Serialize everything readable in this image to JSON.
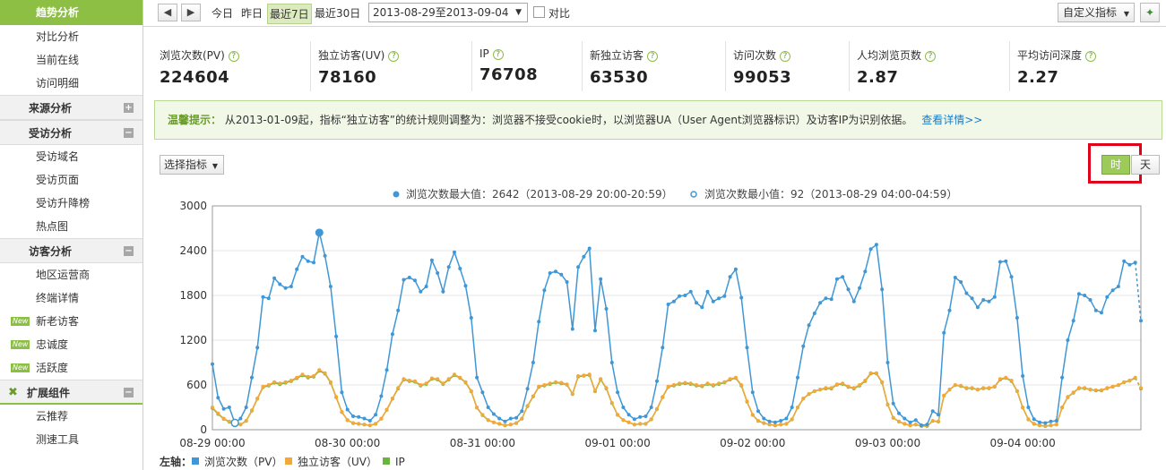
{
  "sidebar": {
    "items": [
      {
        "label": "趋势分析",
        "type": "active"
      },
      {
        "label": "对比分析",
        "type": "item"
      },
      {
        "label": "当前在线",
        "type": "item"
      },
      {
        "label": "访问明细",
        "type": "item"
      },
      {
        "label": "来源分析",
        "type": "group",
        "toggle": "+"
      },
      {
        "label": "受访分析",
        "type": "group",
        "toggle": "−"
      },
      {
        "label": "受访域名",
        "type": "item"
      },
      {
        "label": "受访页面",
        "type": "item"
      },
      {
        "label": "受访升降榜",
        "type": "item"
      },
      {
        "label": "热点图",
        "type": "item"
      },
      {
        "label": "访客分析",
        "type": "group",
        "toggle": "−"
      },
      {
        "label": "地区运营商",
        "type": "item"
      },
      {
        "label": "终端详情",
        "type": "item"
      },
      {
        "label": "新老访客",
        "type": "item",
        "badge": "New"
      },
      {
        "label": "忠诚度",
        "type": "item",
        "badge": "New"
      },
      {
        "label": "活跃度",
        "type": "item",
        "badge": "New"
      },
      {
        "label": "扩展组件",
        "type": "ext",
        "toggle": "−"
      },
      {
        "label": "云推荐",
        "type": "item"
      },
      {
        "label": "测速工具",
        "type": "item"
      }
    ]
  },
  "toolbar": {
    "today": "今日",
    "yesterday": "昨日",
    "last7": "最近7日",
    "last30": "最近30日",
    "date_range": "2013-08-29至2013-09-04",
    "compare": "对比",
    "custom_metric": "自定义指标"
  },
  "metrics": [
    {
      "label": "浏览次数(PV)",
      "value": "224604"
    },
    {
      "label": "独立访客(UV)",
      "value": "78160"
    },
    {
      "label": "IP",
      "value": "76708"
    },
    {
      "label": "新独立访客",
      "value": "63530"
    },
    {
      "label": "访问次数",
      "value": "99053"
    },
    {
      "label": "人均浏览页数",
      "value": "2.87"
    },
    {
      "label": "平均访问深度",
      "value": "2.27"
    }
  ],
  "notice": {
    "tip": "温馨提示：",
    "text": "从2013-01-09起，指标“独立访客”的统计规则调整为：浏览器不接受cookie时，以浏览器UA（User Agent浏览器标识）及访客IP为识别依据。",
    "link": "查看详情>>"
  },
  "controls": {
    "select_metric": "选择指标",
    "granularity_hour": "时",
    "granularity_day": "天"
  },
  "colors": {
    "pv": "#3f97d6",
    "uv": "#f2a93b",
    "ip": "#6cb33e",
    "accent": "#8dbf45",
    "highlight": "#e1001a"
  },
  "chart_data": {
    "type": "line",
    "max_note": "浏览次数最大值：2642（2013-08-29 20:00-20:59）",
    "min_note": "浏览次数最小值：92（2013-08-29 04:00-04:59）",
    "ylim": [
      0,
      3000
    ],
    "yticks": [
      "0",
      "600",
      "1200",
      "1800",
      "2400",
      "3000"
    ],
    "xticks": [
      "08-29 00:00",
      "08-30 00:00",
      "08-31 00:00",
      "09-01 00:00",
      "09-02 00:00",
      "09-03 00:00",
      "09-04 00:00"
    ],
    "legend_prefix": "左轴：",
    "series": [
      {
        "name": "浏览次数（PV）",
        "color": "#3f97d6",
        "values": [
          880,
          430,
          280,
          300,
          92,
          150,
          300,
          700,
          1100,
          1780,
          1760,
          2030,
          1950,
          1900,
          1920,
          2150,
          2320,
          2260,
          2240,
          2642,
          2330,
          1920,
          1250,
          500,
          270,
          180,
          170,
          150,
          120,
          200,
          450,
          800,
          1280,
          1600,
          2010,
          2040,
          2000,
          1850,
          1920,
          2270,
          2100,
          1850,
          2180,
          2380,
          2160,
          1930,
          1500,
          700,
          500,
          300,
          210,
          150,
          110,
          150,
          160,
          250,
          550,
          900,
          1450,
          1870,
          2100,
          2120,
          2080,
          1980,
          1350,
          2180,
          2320,
          2430,
          1330,
          2020,
          1620,
          900,
          500,
          300,
          200,
          140,
          170,
          180,
          300,
          650,
          1100,
          1680,
          1720,
          1790,
          1800,
          1850,
          1700,
          1640,
          1850,
          1720,
          1760,
          1790,
          2050,
          2150,
          1770,
          1100,
          500,
          250,
          150,
          110,
          100,
          120,
          150,
          300,
          700,
          1120,
          1400,
          1560,
          1700,
          1760,
          1750,
          2020,
          2050,
          1880,
          1720,
          1900,
          2120,
          2420,
          2480,
          1880,
          900,
          350,
          220,
          150,
          100,
          130,
          60,
          70,
          250,
          200,
          1300,
          1600,
          2040,
          1980,
          1830,
          1760,
          1640,
          1740,
          1720,
          1780,
          2250,
          2260,
          2050,
          1500,
          720,
          300,
          140,
          100,
          90,
          110,
          120,
          700,
          1200,
          1460,
          1820,
          1800,
          1740,
          1600,
          1570,
          1780,
          1870,
          1920,
          2260,
          2210,
          2240,
          1460
        ]
      },
      {
        "name": "独立访客（UV）",
        "color": "#f2a93b",
        "values": [
          300,
          220,
          150,
          110,
          80,
          70,
          120,
          260,
          420,
          580,
          600,
          640,
          620,
          640,
          660,
          700,
          740,
          710,
          720,
          800,
          760,
          640,
          440,
          240,
          130,
          90,
          80,
          70,
          60,
          80,
          150,
          270,
          420,
          560,
          680,
          660,
          650,
          600,
          620,
          690,
          680,
          620,
          680,
          740,
          700,
          640,
          520,
          300,
          200,
          130,
          100,
          80,
          60,
          70,
          90,
          150,
          320,
          450,
          580,
          600,
          620,
          640,
          630,
          610,
          480,
          720,
          730,
          740,
          520,
          680,
          560,
          360,
          200,
          130,
          100,
          70,
          80,
          80,
          140,
          280,
          440,
          580,
          600,
          620,
          630,
          620,
          600,
          590,
          620,
          600,
          620,
          640,
          680,
          700,
          600,
          380,
          200,
          120,
          90,
          70,
          60,
          70,
          80,
          140,
          300,
          420,
          480,
          520,
          540,
          560,
          560,
          610,
          620,
          580,
          560,
          600,
          660,
          760,
          760,
          640,
          340,
          160,
          110,
          80,
          60,
          70,
          50,
          50,
          120,
          110,
          460,
          540,
          600,
          590,
          560,
          560,
          540,
          560,
          560,
          580,
          680,
          700,
          660,
          520,
          300,
          140,
          80,
          60,
          50,
          60,
          70,
          300,
          440,
          500,
          560,
          560,
          540,
          530,
          530,
          560,
          580,
          600,
          640,
          660,
          700,
          560
        ]
      },
      {
        "name": "IP",
        "color": "#6cb33e",
        "values": [
          290,
          210,
          145,
          105,
          78,
          68,
          118,
          255,
          415,
          570,
          590,
          630,
          610,
          630,
          650,
          690,
          730,
          700,
          710,
          790,
          750,
          630,
          435,
          235,
          128,
          88,
          78,
          68,
          58,
          78,
          148,
          265,
          415,
          552,
          672,
          652,
          642,
          592,
          612,
          682,
          672,
          612,
          672,
          732,
          692,
          632,
          512,
          295,
          195,
          128,
          98,
          78,
          58,
          68,
          88,
          148,
          316,
          445,
          572,
          592,
          612,
          632,
          622,
          602,
          476,
          712,
          722,
          732,
          515,
          672,
          552,
          355,
          198,
          128,
          98,
          68,
          78,
          78,
          138,
          276,
          436,
          572,
          592,
          612,
          622,
          612,
          592,
          582,
          612,
          592,
          612,
          632,
          672,
          692,
          592,
          376,
          198,
          118,
          88,
          68,
          58,
          68,
          78,
          138,
          296,
          416,
          476,
          516,
          536,
          552,
          552,
          602,
          612,
          572,
          552,
          592,
          652,
          752,
          752,
          632,
          336,
          158,
          108,
          78,
          58,
          68,
          48,
          48,
          118,
          108,
          456,
          536,
          596,
          586,
          556,
          556,
          536,
          556,
          556,
          576,
          672,
          692,
          652,
          516,
          296,
          138,
          78,
          58,
          48,
          58,
          68,
          296,
          436,
          496,
          556,
          556,
          536,
          526,
          526,
          556,
          576,
          596,
          636,
          656,
          692,
          552
        ]
      }
    ]
  }
}
